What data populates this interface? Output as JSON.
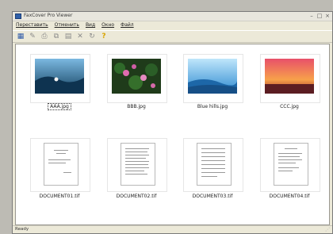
{
  "window": {
    "title": "FaxCover Pro Viewer"
  },
  "menu": [
    "Переставить",
    "Отменить",
    "Вид",
    "Окно",
    "Файл"
  ],
  "toolbar": [
    {
      "icon": "view-icon",
      "glyph": "▦"
    },
    {
      "icon": "edit-icon",
      "glyph": "✎"
    },
    {
      "icon": "print-icon",
      "glyph": "⎙"
    },
    {
      "icon": "copy-icon",
      "glyph": "⧉"
    },
    {
      "icon": "paste-icon",
      "glyph": "▤"
    },
    {
      "icon": "delete-icon",
      "glyph": "✕"
    },
    {
      "icon": "refresh-icon",
      "glyph": "↻"
    },
    {
      "icon": "help-icon",
      "glyph": "?"
    }
  ],
  "files": [
    {
      "name": "AAA.jpg",
      "selected": true
    },
    {
      "name": "BBB.jpg",
      "selected": false
    },
    {
      "name": "Blue hills.jpg",
      "selected": false
    },
    {
      "name": "CCC.jpg",
      "selected": false
    },
    {
      "name": "DOCUMENT01.tif",
      "selected": false
    },
    {
      "name": "DOCUMENT02.tif",
      "selected": false
    },
    {
      "name": "DOCUMENT03.tif",
      "selected": false
    },
    {
      "name": "DOCUMENT04.tif",
      "selected": false
    }
  ],
  "status": {
    "text": "Ready"
  }
}
